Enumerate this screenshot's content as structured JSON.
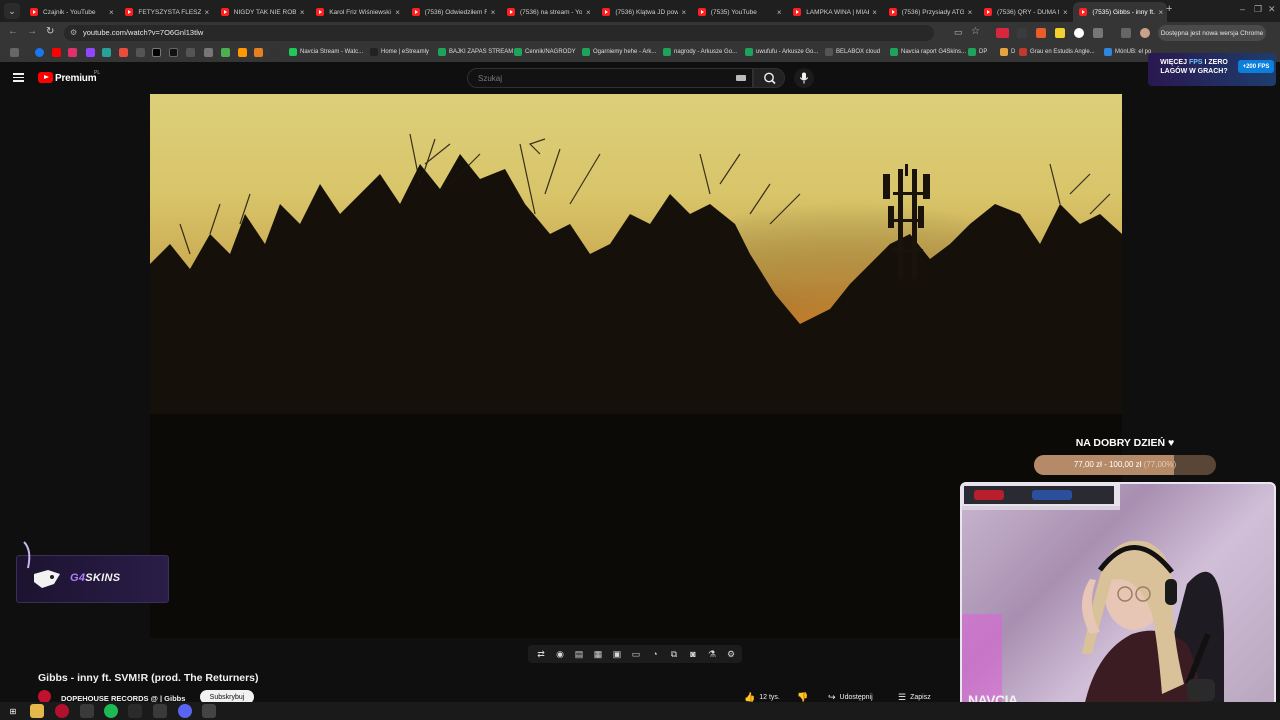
{
  "browser": {
    "tabs": [
      {
        "title": "Czajnik - YouTube",
        "active": false
      },
      {
        "title": "FETYSZYSTA FLESZOW",
        "active": false
      },
      {
        "title": "NIGDY TAK NIE ROBIL",
        "active": false
      },
      {
        "title": "Karol Friz Wiśniewski",
        "active": false
      },
      {
        "title": "(7536) Odwiedziłem F",
        "active": false
      },
      {
        "title": "(7536) na stream - Yo",
        "active": false
      },
      {
        "title": "(7536) Klątwa JD pow",
        "active": false
      },
      {
        "title": "(7535) YouTube",
        "active": false
      },
      {
        "title": "LAMPKA WINA | MIAŁ",
        "active": false
      },
      {
        "title": "(7536) Przysiady ATG",
        "active": false
      },
      {
        "title": "(7536) QRY - DUMA f",
        "active": false
      },
      {
        "title": "(7535) Gibbs - inny ft.",
        "active": true
      }
    ],
    "url": "youtube.com/watch?v=7O6Gnl13tlw",
    "update_pill": "Dostępna jest nowa wersja Chrome",
    "bookmarks": [
      {
        "label": "Navcia Stream - Watc...",
        "color": "#1ec95a"
      },
      {
        "label": "Home | eStreamly",
        "color": "#222222"
      },
      {
        "label": "BAJKI ZAPAS STREAM",
        "color": "#1ea35a"
      },
      {
        "label": "Cennik/NAGRODY",
        "color": "#1ea35a"
      },
      {
        "label": "Ogarniemy hehe - Ark...",
        "color": "#1ea35a"
      },
      {
        "label": "nagrody - Arkusze Go...",
        "color": "#1ea35a"
      },
      {
        "label": "uwufufu - Arkusze Go...",
        "color": "#1ea35a"
      },
      {
        "label": "BELABOX cloud",
        "color": "#555555"
      },
      {
        "label": "Navcia raport G4Skins...",
        "color": "#1ea35a"
      },
      {
        "label": "DP",
        "color": "#1ea35a"
      },
      {
        "label": "D",
        "color": "#e6a23c"
      },
      {
        "label": "Grau en Estudis Angle...",
        "color": "#c0392b"
      },
      {
        "label": "MónUB: el po",
        "color": "#2e86de"
      }
    ]
  },
  "youtube": {
    "logo_text": "Premium",
    "logo_region": "PL",
    "search_placeholder": "Szukaj",
    "video_title": "Gibbs - inny ft. SVM!R (prod. The Returners)",
    "channel_name": "DOPEHOUSE RECORDS @ | Gibbs",
    "subscribe_label": "Subskrybuj",
    "likes": "12 tys.",
    "share_label": "Udostępnij",
    "save_label": "Zapisz"
  },
  "overlays": {
    "ad_fps": {
      "line1": "WIĘCEJ",
      "accent1": "FPS",
      "line1b": "I ZERO",
      "line2": "LAGÓW W GRACH?",
      "badge": "+200 FPS"
    },
    "sponsor": {
      "prefix": "G4",
      "name": "SKINS"
    },
    "goal": {
      "title": "NA DOBRY DZIEŃ ♥",
      "amount": "77,00 zł - 100,00 zł",
      "percent_text": "(77,00%)",
      "fraction": 0.77
    },
    "webcam_name": "NAVCIA"
  },
  "icons": {
    "menu": "hamburger-icon",
    "search": "search-icon",
    "mic": "microphone-icon",
    "keyboard": "keyboard-icon",
    "settings": "gear-icon"
  },
  "colors": {
    "yt_red": "#ff0000",
    "goal_fill": "#b48a68",
    "sponsor_purple": "#b07bff"
  }
}
